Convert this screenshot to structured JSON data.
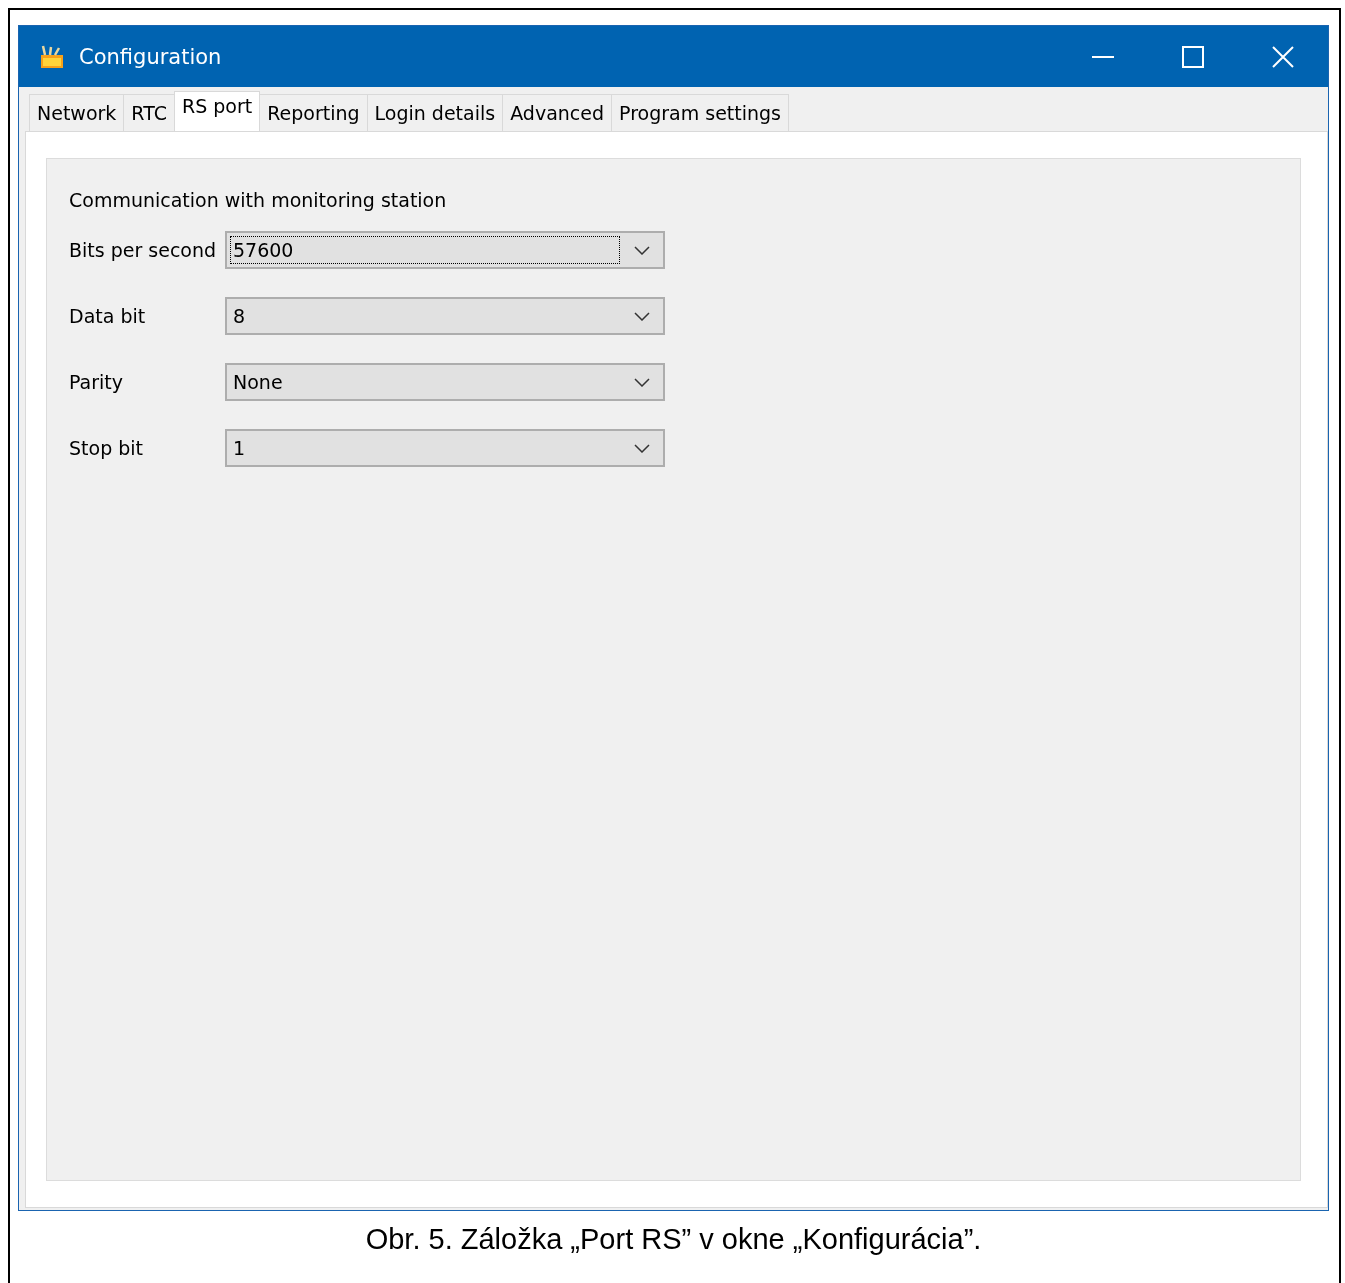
{
  "window": {
    "title": "Configuration"
  },
  "tabs": [
    {
      "label": "Network",
      "selected": false
    },
    {
      "label": "RTC",
      "selected": false
    },
    {
      "label": "RS port",
      "selected": true
    },
    {
      "label": "Reporting",
      "selected": false
    },
    {
      "label": "Login details",
      "selected": false
    },
    {
      "label": "Advanced",
      "selected": false
    },
    {
      "label": "Program settings",
      "selected": false
    }
  ],
  "group": {
    "title": "Communication with monitoring station"
  },
  "fields": [
    {
      "label": "Bits per second",
      "value": "57600",
      "focused": true
    },
    {
      "label": "Data bit",
      "value": "8",
      "focused": false
    },
    {
      "label": "Parity",
      "value": "None",
      "focused": false
    },
    {
      "label": "Stop bit",
      "value": "1",
      "focused": false
    }
  ],
  "caption": "Obr. 5. Záložka „Port RS” v okne „Konfigurácia”."
}
